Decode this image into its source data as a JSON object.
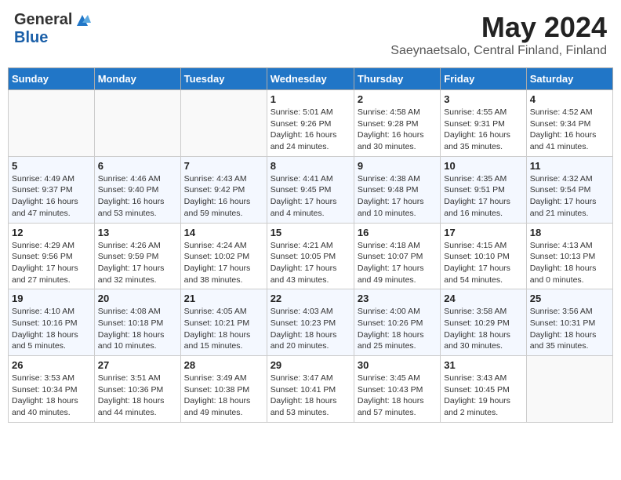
{
  "header": {
    "logo_general": "General",
    "logo_blue": "Blue",
    "month_year": "May 2024",
    "location": "Saeynaetsalo, Central Finland, Finland"
  },
  "days_of_week": [
    "Sunday",
    "Monday",
    "Tuesday",
    "Wednesday",
    "Thursday",
    "Friday",
    "Saturday"
  ],
  "weeks": [
    [
      {
        "day": "",
        "info": ""
      },
      {
        "day": "",
        "info": ""
      },
      {
        "day": "",
        "info": ""
      },
      {
        "day": "1",
        "info": "Sunrise: 5:01 AM\nSunset: 9:26 PM\nDaylight: 16 hours\nand 24 minutes."
      },
      {
        "day": "2",
        "info": "Sunrise: 4:58 AM\nSunset: 9:28 PM\nDaylight: 16 hours\nand 30 minutes."
      },
      {
        "day": "3",
        "info": "Sunrise: 4:55 AM\nSunset: 9:31 PM\nDaylight: 16 hours\nand 35 minutes."
      },
      {
        "day": "4",
        "info": "Sunrise: 4:52 AM\nSunset: 9:34 PM\nDaylight: 16 hours\nand 41 minutes."
      }
    ],
    [
      {
        "day": "5",
        "info": "Sunrise: 4:49 AM\nSunset: 9:37 PM\nDaylight: 16 hours\nand 47 minutes."
      },
      {
        "day": "6",
        "info": "Sunrise: 4:46 AM\nSunset: 9:40 PM\nDaylight: 16 hours\nand 53 minutes."
      },
      {
        "day": "7",
        "info": "Sunrise: 4:43 AM\nSunset: 9:42 PM\nDaylight: 16 hours\nand 59 minutes."
      },
      {
        "day": "8",
        "info": "Sunrise: 4:41 AM\nSunset: 9:45 PM\nDaylight: 17 hours\nand 4 minutes."
      },
      {
        "day": "9",
        "info": "Sunrise: 4:38 AM\nSunset: 9:48 PM\nDaylight: 17 hours\nand 10 minutes."
      },
      {
        "day": "10",
        "info": "Sunrise: 4:35 AM\nSunset: 9:51 PM\nDaylight: 17 hours\nand 16 minutes."
      },
      {
        "day": "11",
        "info": "Sunrise: 4:32 AM\nSunset: 9:54 PM\nDaylight: 17 hours\nand 21 minutes."
      }
    ],
    [
      {
        "day": "12",
        "info": "Sunrise: 4:29 AM\nSunset: 9:56 PM\nDaylight: 17 hours\nand 27 minutes."
      },
      {
        "day": "13",
        "info": "Sunrise: 4:26 AM\nSunset: 9:59 PM\nDaylight: 17 hours\nand 32 minutes."
      },
      {
        "day": "14",
        "info": "Sunrise: 4:24 AM\nSunset: 10:02 PM\nDaylight: 17 hours\nand 38 minutes."
      },
      {
        "day": "15",
        "info": "Sunrise: 4:21 AM\nSunset: 10:05 PM\nDaylight: 17 hours\nand 43 minutes."
      },
      {
        "day": "16",
        "info": "Sunrise: 4:18 AM\nSunset: 10:07 PM\nDaylight: 17 hours\nand 49 minutes."
      },
      {
        "day": "17",
        "info": "Sunrise: 4:15 AM\nSunset: 10:10 PM\nDaylight: 17 hours\nand 54 minutes."
      },
      {
        "day": "18",
        "info": "Sunrise: 4:13 AM\nSunset: 10:13 PM\nDaylight: 18 hours\nand 0 minutes."
      }
    ],
    [
      {
        "day": "19",
        "info": "Sunrise: 4:10 AM\nSunset: 10:16 PM\nDaylight: 18 hours\nand 5 minutes."
      },
      {
        "day": "20",
        "info": "Sunrise: 4:08 AM\nSunset: 10:18 PM\nDaylight: 18 hours\nand 10 minutes."
      },
      {
        "day": "21",
        "info": "Sunrise: 4:05 AM\nSunset: 10:21 PM\nDaylight: 18 hours\nand 15 minutes."
      },
      {
        "day": "22",
        "info": "Sunrise: 4:03 AM\nSunset: 10:23 PM\nDaylight: 18 hours\nand 20 minutes."
      },
      {
        "day": "23",
        "info": "Sunrise: 4:00 AM\nSunset: 10:26 PM\nDaylight: 18 hours\nand 25 minutes."
      },
      {
        "day": "24",
        "info": "Sunrise: 3:58 AM\nSunset: 10:29 PM\nDaylight: 18 hours\nand 30 minutes."
      },
      {
        "day": "25",
        "info": "Sunrise: 3:56 AM\nSunset: 10:31 PM\nDaylight: 18 hours\nand 35 minutes."
      }
    ],
    [
      {
        "day": "26",
        "info": "Sunrise: 3:53 AM\nSunset: 10:34 PM\nDaylight: 18 hours\nand 40 minutes."
      },
      {
        "day": "27",
        "info": "Sunrise: 3:51 AM\nSunset: 10:36 PM\nDaylight: 18 hours\nand 44 minutes."
      },
      {
        "day": "28",
        "info": "Sunrise: 3:49 AM\nSunset: 10:38 PM\nDaylight: 18 hours\nand 49 minutes."
      },
      {
        "day": "29",
        "info": "Sunrise: 3:47 AM\nSunset: 10:41 PM\nDaylight: 18 hours\nand 53 minutes."
      },
      {
        "day": "30",
        "info": "Sunrise: 3:45 AM\nSunset: 10:43 PM\nDaylight: 18 hours\nand 57 minutes."
      },
      {
        "day": "31",
        "info": "Sunrise: 3:43 AM\nSunset: 10:45 PM\nDaylight: 19 hours\nand 2 minutes."
      },
      {
        "day": "",
        "info": ""
      }
    ]
  ]
}
